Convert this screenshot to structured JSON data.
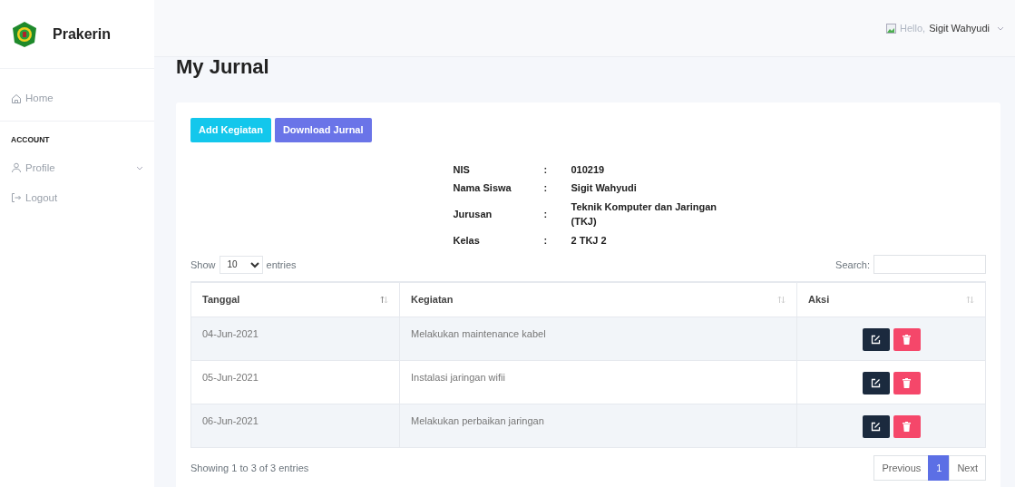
{
  "brand": {
    "name": "Prakerin"
  },
  "sidebar": {
    "items": [
      {
        "kind": "home",
        "label": "Home",
        "selected": false
      },
      {
        "kind": "heading",
        "label": "ACCOUNT"
      },
      {
        "kind": "profile",
        "label": "Profile",
        "expandable": true,
        "selected": false
      },
      {
        "kind": "logout",
        "label": "Logout",
        "selected": false
      }
    ]
  },
  "topbar": {
    "greeting": "Hello,",
    "user": "Sigit Wahyudi"
  },
  "page_title": "My Jurnal",
  "buttons": [
    {
      "label": "Add Kegiatan",
      "kind": "info"
    },
    {
      "label": "Download Jurnal",
      "kind": "primary"
    }
  ],
  "student": [
    {
      "label": "NIS",
      "separator": ":",
      "value": "010219"
    },
    {
      "label": "Nama Siswa",
      "separator": ":",
      "value": "Sigit Wahyudi"
    },
    {
      "label": "Jurusan",
      "separator": ":",
      "value": "Teknik Komputer dan Jaringan (TKJ)"
    },
    {
      "label": "Kelas",
      "separator": ":",
      "value": "2 TKJ 2"
    }
  ],
  "length_control": {
    "before": "Show",
    "value": "10",
    "after": "entries"
  },
  "search": {
    "label": "Search:"
  },
  "table": {
    "columns": [
      {
        "label": "Tanggal",
        "sorted": true
      },
      {
        "label": "Kegiatan",
        "sorted": false
      },
      {
        "label": "Aksi",
        "sorted": false
      }
    ],
    "rows": [
      {
        "date": "04-Jun-2021",
        "activity": "Melakukan maintenance kabel"
      },
      {
        "date": "05-Jun-2021",
        "activity": "Instalasi jaringan wifii"
      },
      {
        "date": "06-Jun-2021",
        "activity": "Melakukan perbaikan jaringan"
      }
    ]
  },
  "info": "Showing 1 to 3 of 3 entries",
  "pagination": [
    {
      "label": "Previous",
      "selected": false
    },
    {
      "label": "1",
      "selected": true
    },
    {
      "label": "Next",
      "selected": false
    }
  ]
}
